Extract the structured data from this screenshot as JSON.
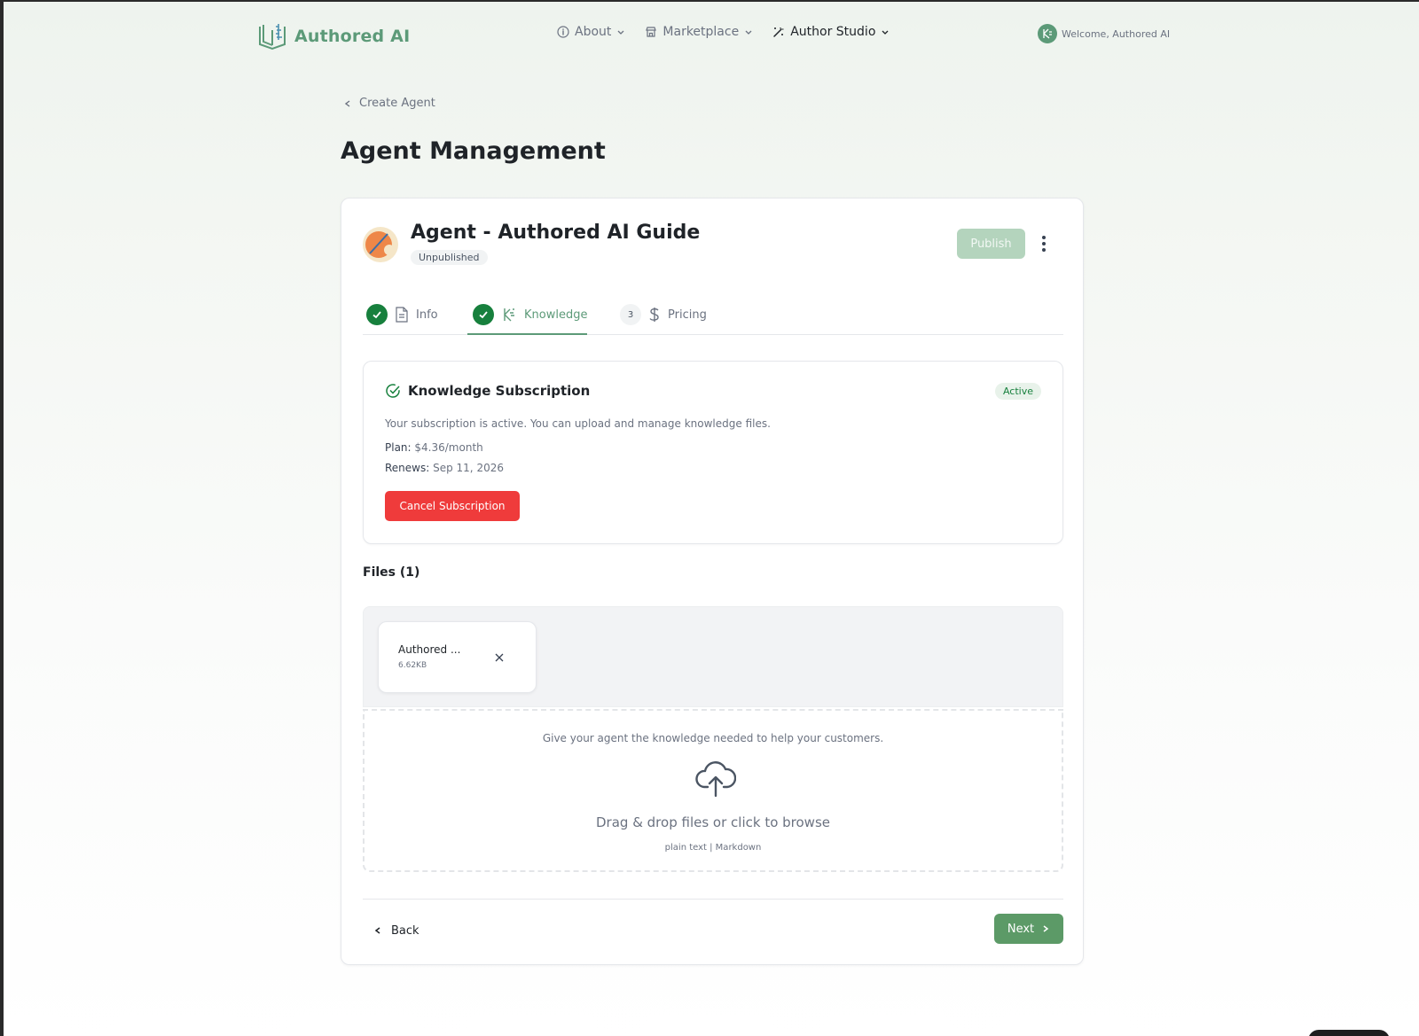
{
  "header": {
    "logo_text": "Authored AI",
    "nav": [
      {
        "label": "About",
        "icon": "info-icon"
      },
      {
        "label": "Marketplace",
        "icon": "store-icon"
      },
      {
        "label": "Author Studio",
        "icon": "magic-wand-icon"
      }
    ],
    "welcome_text": "Welcome, Authored AI"
  },
  "breadcrumb": {
    "label": "Create Agent"
  },
  "page": {
    "title": "Agent Management"
  },
  "agent": {
    "name": "Agent - Authored AI Guide",
    "status": "Unpublished",
    "publish_label": "Publish"
  },
  "tabs": [
    {
      "label": "Info",
      "state": "done"
    },
    {
      "label": "Knowledge",
      "state": "done",
      "active": true
    },
    {
      "label": "Pricing",
      "step": "3"
    }
  ],
  "subscription": {
    "title": "Knowledge Subscription",
    "badge": "Active",
    "description": "Your subscription is active. You can upload and manage knowledge files.",
    "plan_label": "Plan:",
    "plan_value": "$4.36/month",
    "renews_label": "Renews:",
    "renews_value": "Sep 11, 2026",
    "cancel_label": "Cancel Subscription"
  },
  "files": {
    "title": "Files (1)",
    "items": [
      {
        "name": "Authored ...",
        "size": "6.62KB"
      }
    ]
  },
  "dropzone": {
    "hint": "Give your agent the knowledge needed to help your customers.",
    "main": "Drag & drop files or click to browse",
    "formats": "plain text | Markdown"
  },
  "footer": {
    "back_label": "Back",
    "next_label": "Next"
  },
  "colors": {
    "brand": "#5c9a78",
    "success": "#17803d",
    "danger": "#ef3b3b",
    "publish_disabled": "#b4d4bd"
  }
}
